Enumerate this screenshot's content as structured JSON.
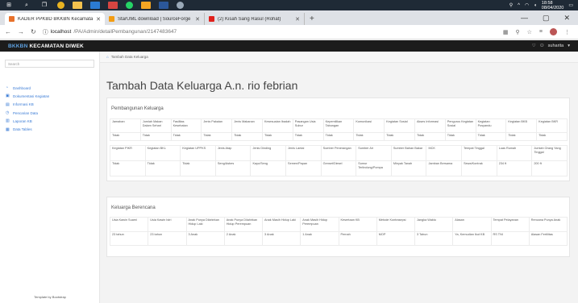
{
  "taskbar": {
    "clock_time": "18:58",
    "clock_date": "08/04/2020"
  },
  "browser": {
    "tabs": [
      {
        "title": "KADER PPKBD BKKBN Kecamatan",
        "favicon_color": "#e8712b"
      },
      {
        "title": "StarUML download | SourceForge",
        "favicon_color": "#f39c12"
      },
      {
        "title": "(2) Kisah Sang Rasul (Rohat)",
        "favicon_color": "#e0201b"
      }
    ],
    "url_host": "localhost",
    "url_path": "/PA/Admin/detailPembangunan/2147483647"
  },
  "topnav": {
    "brand_bold": "BKKBN",
    "brand_rest": "KECAMATAN DIWEK",
    "user": "suharita"
  },
  "sidebar": {
    "search_placeholder": "Search",
    "items": [
      {
        "label": "Dashboard"
      },
      {
        "label": "Dokumentasi Kegiatan"
      },
      {
        "label": "Informasi KB"
      },
      {
        "label": "Pencarian Data"
      },
      {
        "label": "Laporan KB"
      },
      {
        "label": "Data Tables"
      }
    ],
    "footer": "Template by Bootstrap"
  },
  "breadcrumb": {
    "label": "Tambah Data Keluarga"
  },
  "page_title": "Tambah Data Keluarga A.n. rio febrian",
  "pembangunan": {
    "heading": "Pembangunan Keluarga",
    "table1": {
      "headers": [
        "Jamaban",
        "Jumlah Makan Dalam Sehari",
        "Fasilitas Kesehatan",
        "Jenis Pakaian",
        "Jenis Makanan",
        "Kesesuaian Ibadah",
        "Pasangan Usia Subur",
        "Kepemilikan Tabungan",
        "Komunikasi",
        "Kegiatan Sosial",
        "Akses Informasi",
        "Pengurus Kegiatan Sosial",
        "Kegiatan Posyandu",
        "Kegiatan BKB",
        "Kegiatan BKR"
      ],
      "values": [
        "Tidak",
        "Tidak",
        "Tidak",
        "Tidak",
        "Tidak",
        "Tidak",
        "Tidak",
        "Tidak",
        "Tidak",
        "Tidak",
        "Tidak",
        "Tidak",
        "Tidak",
        "Tidak",
        "Tidak"
      ]
    },
    "table2": {
      "headers": [
        "Kegiatan PIKR",
        "Kegiatan BKL",
        "Kegiatan UPPKS",
        "Jenis Atap",
        "Jenis Dinding",
        "Jenis Lantai",
        "Sumber Penerangan",
        "Sumber Air",
        "Sumber Bahan Bakar",
        "MCK",
        "Tempat Tinggal",
        "Luas Rumah",
        "Jumlah Orang Yang Tinggal"
      ],
      "values": [
        "Tidak",
        "Tidak",
        "Tidak",
        "Seng/Asbes",
        "Kayu/Seng",
        "Semen/Papan",
        "Genset/Diesel",
        "Sumur Terlindung/Pompa",
        "Minyak Tanah",
        "Jamban Bersama",
        "Sewa/Kontrak",
        "234 ft",
        "200 ft"
      ]
    }
  },
  "berencana": {
    "heading": "Keluarga Berencana",
    "table": {
      "headers": [
        "Usia Kawin Suami",
        "Usia Kawin Istri",
        "Anak Punya Dilahirkan Hidup Laki",
        "Anak Punya Dilahirkan Hidup Perempuan",
        "Anak Masih Hidup Laki",
        "Anak Masih Hidup Perempuan",
        "Kesertaan KB",
        "Metode Kontrasepsi",
        "Jangka Waktu",
        "Alasan",
        "Tempat Pelayanan",
        "Rencana Punya Anak"
      ],
      "values": [
        "23 tahun",
        "23 tahun",
        "3 Anak",
        "2 Anak",
        "3 Anak",
        "1 Anak",
        "Pernah",
        "MOP",
        "3 Tahun",
        "Ya, Kemudian Ikut KB",
        "RS TNI",
        "Alasan Fertilitas"
      ]
    }
  }
}
